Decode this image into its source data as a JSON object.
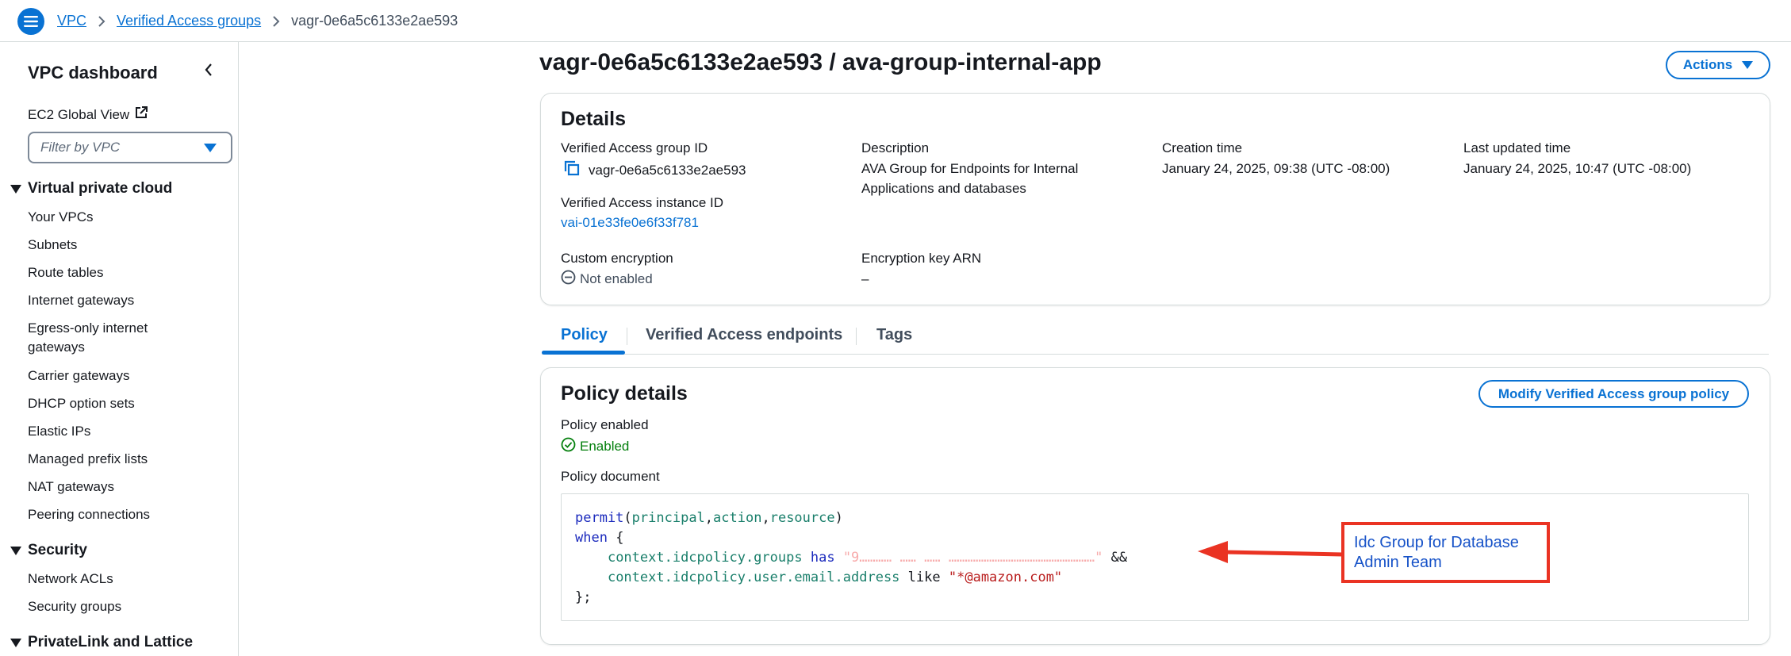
{
  "breadcrumb": {
    "items": [
      "VPC",
      "Verified Access groups"
    ],
    "current": "vagr-0e6a5c6133e2ae593"
  },
  "sidebar": {
    "title": "VPC dashboard",
    "ec2_global_view": "EC2 Global View",
    "filter_placeholder": "Filter by VPC",
    "section_vpc": "Virtual private cloud",
    "vpc_items": [
      "Your VPCs",
      "Subnets",
      "Route tables",
      "Internet gateways",
      "Egress-only internet gateways",
      "Carrier gateways",
      "DHCP option sets",
      "Elastic IPs",
      "Managed prefix lists",
      "NAT gateways",
      "Peering connections"
    ],
    "section_security": "Security",
    "security_items": [
      "Network ACLs",
      "Security groups"
    ],
    "section_privatelink": "PrivateLink and Lattice"
  },
  "page": {
    "title": "vagr-0e6a5c6133e2ae593 / ava-group-internal-app",
    "actions_label": "Actions"
  },
  "details": {
    "title": "Details",
    "group_id_label": "Verified Access group ID",
    "group_id_value": "vagr-0e6a5c6133e2ae593",
    "description_label": "Description",
    "description_line1": "AVA Group for Endpoints for Internal",
    "description_line2": "Applications and databases",
    "creation_label": "Creation time",
    "creation_value": "January 24, 2025, 09:38 (UTC -08:00)",
    "updated_label": "Last updated time",
    "updated_value": "January 24, 2025, 10:47 (UTC -08:00)",
    "instance_label": "Verified Access instance ID",
    "instance_value": "vai-01e33fe0e6f33f781",
    "encryption_label": "Custom encryption",
    "encryption_value": "Not enabled",
    "key_arn_label": "Encryption key ARN",
    "key_arn_value": "–"
  },
  "tabs": [
    "Policy",
    "Verified Access endpoints",
    "Tags"
  ],
  "policy": {
    "title": "Policy details",
    "modify_label": "Modify Verified Access group policy",
    "enabled_label": "Policy enabled",
    "enabled_value": "Enabled",
    "document_label": "Policy document",
    "code": {
      "permit": "permit",
      "principal": "principal",
      "action": "action",
      "resource": "resource",
      "when": "when",
      "groups_path": "context.idcpolicy.groups",
      "has": "has",
      "groups_value": "\"9………… …… …… ………………………………………………\"",
      "and": "&&",
      "email_path": "context.idcpolicy.user.email.address",
      "like": "like",
      "email_value": "\"*@amazon.com\"",
      "close": "};"
    }
  },
  "annotation": {
    "text": "Idc Group for Database Admin Team",
    "color": "#ea3323"
  }
}
